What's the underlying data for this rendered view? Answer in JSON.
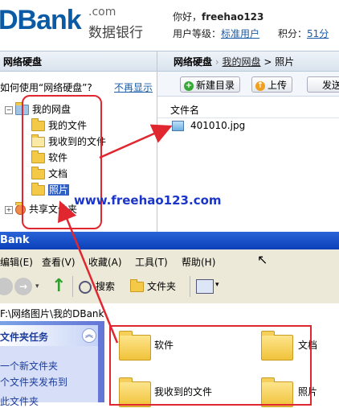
{
  "header": {
    "logo_text": "DBank",
    "logo_suffix": ".com",
    "logo_cn": "数据银行",
    "greeting_prefix": "你好，",
    "username": "freehao123",
    "level_label": "用户等级：",
    "level_value": "标准用户",
    "points_label": "积分：",
    "points_value": "51分"
  },
  "left_panel": {
    "title": "网络硬盘",
    "help_text": "如何使用“网络硬盘”?",
    "hide_link": "不再显示",
    "tree": {
      "root": "我的网盘",
      "children": [
        "我的文件",
        "我收到的文件",
        "软件",
        "文档",
        "照片"
      ],
      "shared": "共享文件夹"
    }
  },
  "right_panel": {
    "breadcrumb": [
      "网络硬盘",
      "我的网盘",
      "照片"
    ],
    "buttons": [
      "新建目录",
      "上传",
      "发送"
    ],
    "column_header": "文件名",
    "files": [
      "401010.jpg"
    ]
  },
  "watermark": "www.freehao123.com",
  "explorer": {
    "title": "Bank",
    "menu": [
      "编辑(E)",
      "查看(V)",
      "收藏(A)",
      "工具(T)",
      "帮助(H)"
    ],
    "toolbar": {
      "search": "搜索",
      "folders": "文件夹"
    },
    "address": "F:\\网络图片\\我的DBank",
    "tasks_header": "文件夹任务",
    "tasks": [
      "一个新文件夹",
      "个文件夹发布到",
      "此文件夹"
    ],
    "folders": [
      "软件",
      "文档",
      "我收到的文件",
      "照片"
    ]
  },
  "colors": {
    "accent": "#1a5ca8",
    "annotation": "#e0262f",
    "xp_title": "#0a3fb8"
  }
}
